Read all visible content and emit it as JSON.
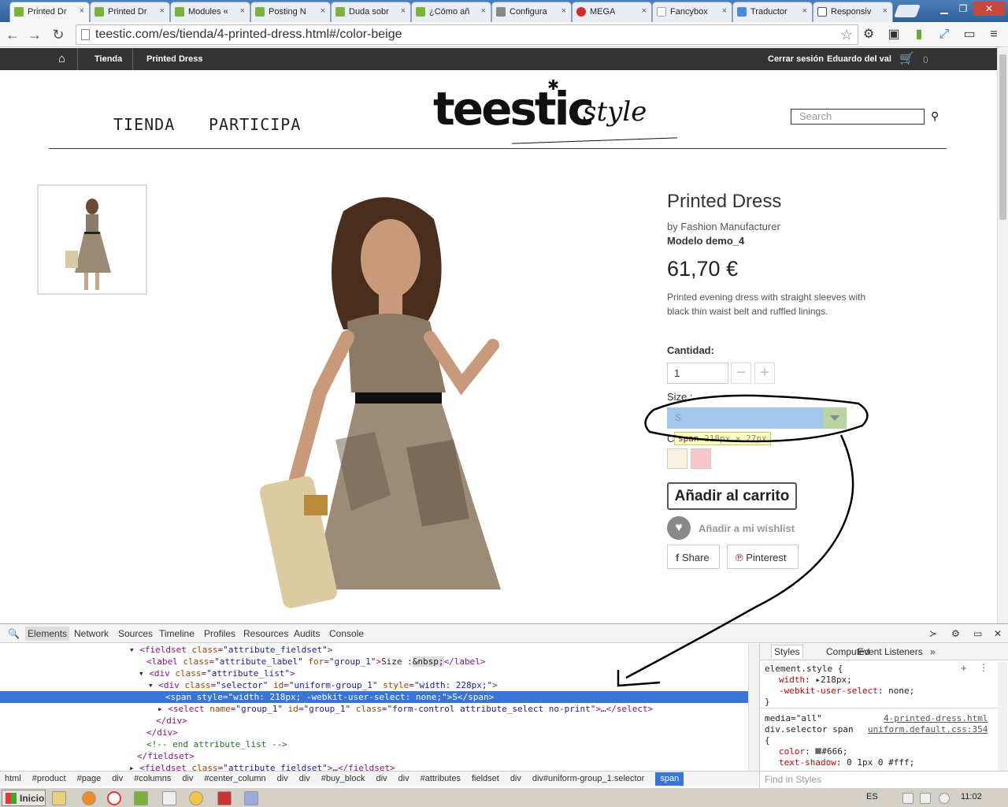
{
  "browser": {
    "tabs": [
      {
        "label": "Printed Dr",
        "active": true
      },
      {
        "label": "Printed Dr",
        "active": false
      },
      {
        "label": "Modules «",
        "active": false
      },
      {
        "label": "Posting N",
        "active": false
      },
      {
        "label": "Duda sobr",
        "active": false
      },
      {
        "label": "¿Cómo añ",
        "active": false
      },
      {
        "label": "Configura",
        "active": false
      },
      {
        "label": "MEGA",
        "active": false
      },
      {
        "label": "Fancybox",
        "active": false
      },
      {
        "label": "Traductor",
        "active": false
      },
      {
        "label": "Responsiv",
        "active": false
      }
    ],
    "tab_close": "×",
    "url": "teestic.com/es/tienda/4-printed-dress.html#/color-beige"
  },
  "site": {
    "breadcrumb": [
      "Tienda",
      "Printed Dress"
    ],
    "logout": "Cerrar sesión",
    "user": "Eduardo del val",
    "cart_count": "0",
    "menu": [
      "TIENDA",
      "PARTICIPA"
    ],
    "logo_text": "teestic",
    "logo_script": "style",
    "search_placeholder": "Search"
  },
  "product": {
    "title": "Printed Dress",
    "manufacturer": "by Fashion Manufacturer",
    "model": "Modelo demo_4",
    "price": "61,70 €",
    "description": "Printed evening dress with straight sleeves with black thin waist belt and ruffled linings.",
    "quantity_label": "Cantidad:",
    "quantity_value": "1",
    "minus": "−",
    "plus": "+",
    "size_label": "Size :",
    "size_value": "S",
    "color_label": "C",
    "colors": [
      "#f5f2de",
      "#f9c6cc"
    ],
    "add_to_cart": "Añadir al carrito",
    "wishlist": "Añadir a mi wishlist",
    "share": "Share",
    "pinterest": "Pinterest"
  },
  "tooltip": {
    "name": "span",
    "size": "218px × 27px"
  },
  "devtools": {
    "tabs": [
      "Elements",
      "Network",
      "Sources",
      "Timeline",
      "Profiles",
      "Resources",
      "Audits",
      "Console"
    ],
    "breadcrumbs": [
      "html",
      "#product",
      "#page",
      "div",
      "#columns",
      "div",
      "#center_column",
      "div",
      "div",
      "#buy_block",
      "div",
      "div",
      "#attributes",
      "fieldset",
      "div",
      "div#uniform-group_1.selector",
      "span"
    ],
    "styles_tabs": [
      "Styles",
      "Computed",
      "Event Listeners"
    ],
    "styles_more": "»",
    "element_style_sel": "element.style {",
    "element_style": [
      {
        "prop": "width",
        "val": "218px;"
      },
      {
        "prop": "-webkit-user-select",
        "val": "none;"
      }
    ],
    "close_brace": "}",
    "media": "media=\"all\"",
    "media_src": "4-printed-dress.html",
    "rule_selector": "div.selector span",
    "rule_src": "uniform.default.css:354",
    "open_brace": "{",
    "rule_props": [
      {
        "prop": "color",
        "val": "#666;"
      },
      {
        "prop": "text-shadow",
        "val": "0 1px 0 #fff;"
      }
    ],
    "find_in_styles": "Find in Styles"
  },
  "taskbar": {
    "start": "Inicio",
    "lang": "ES",
    "clock": "11:02"
  }
}
